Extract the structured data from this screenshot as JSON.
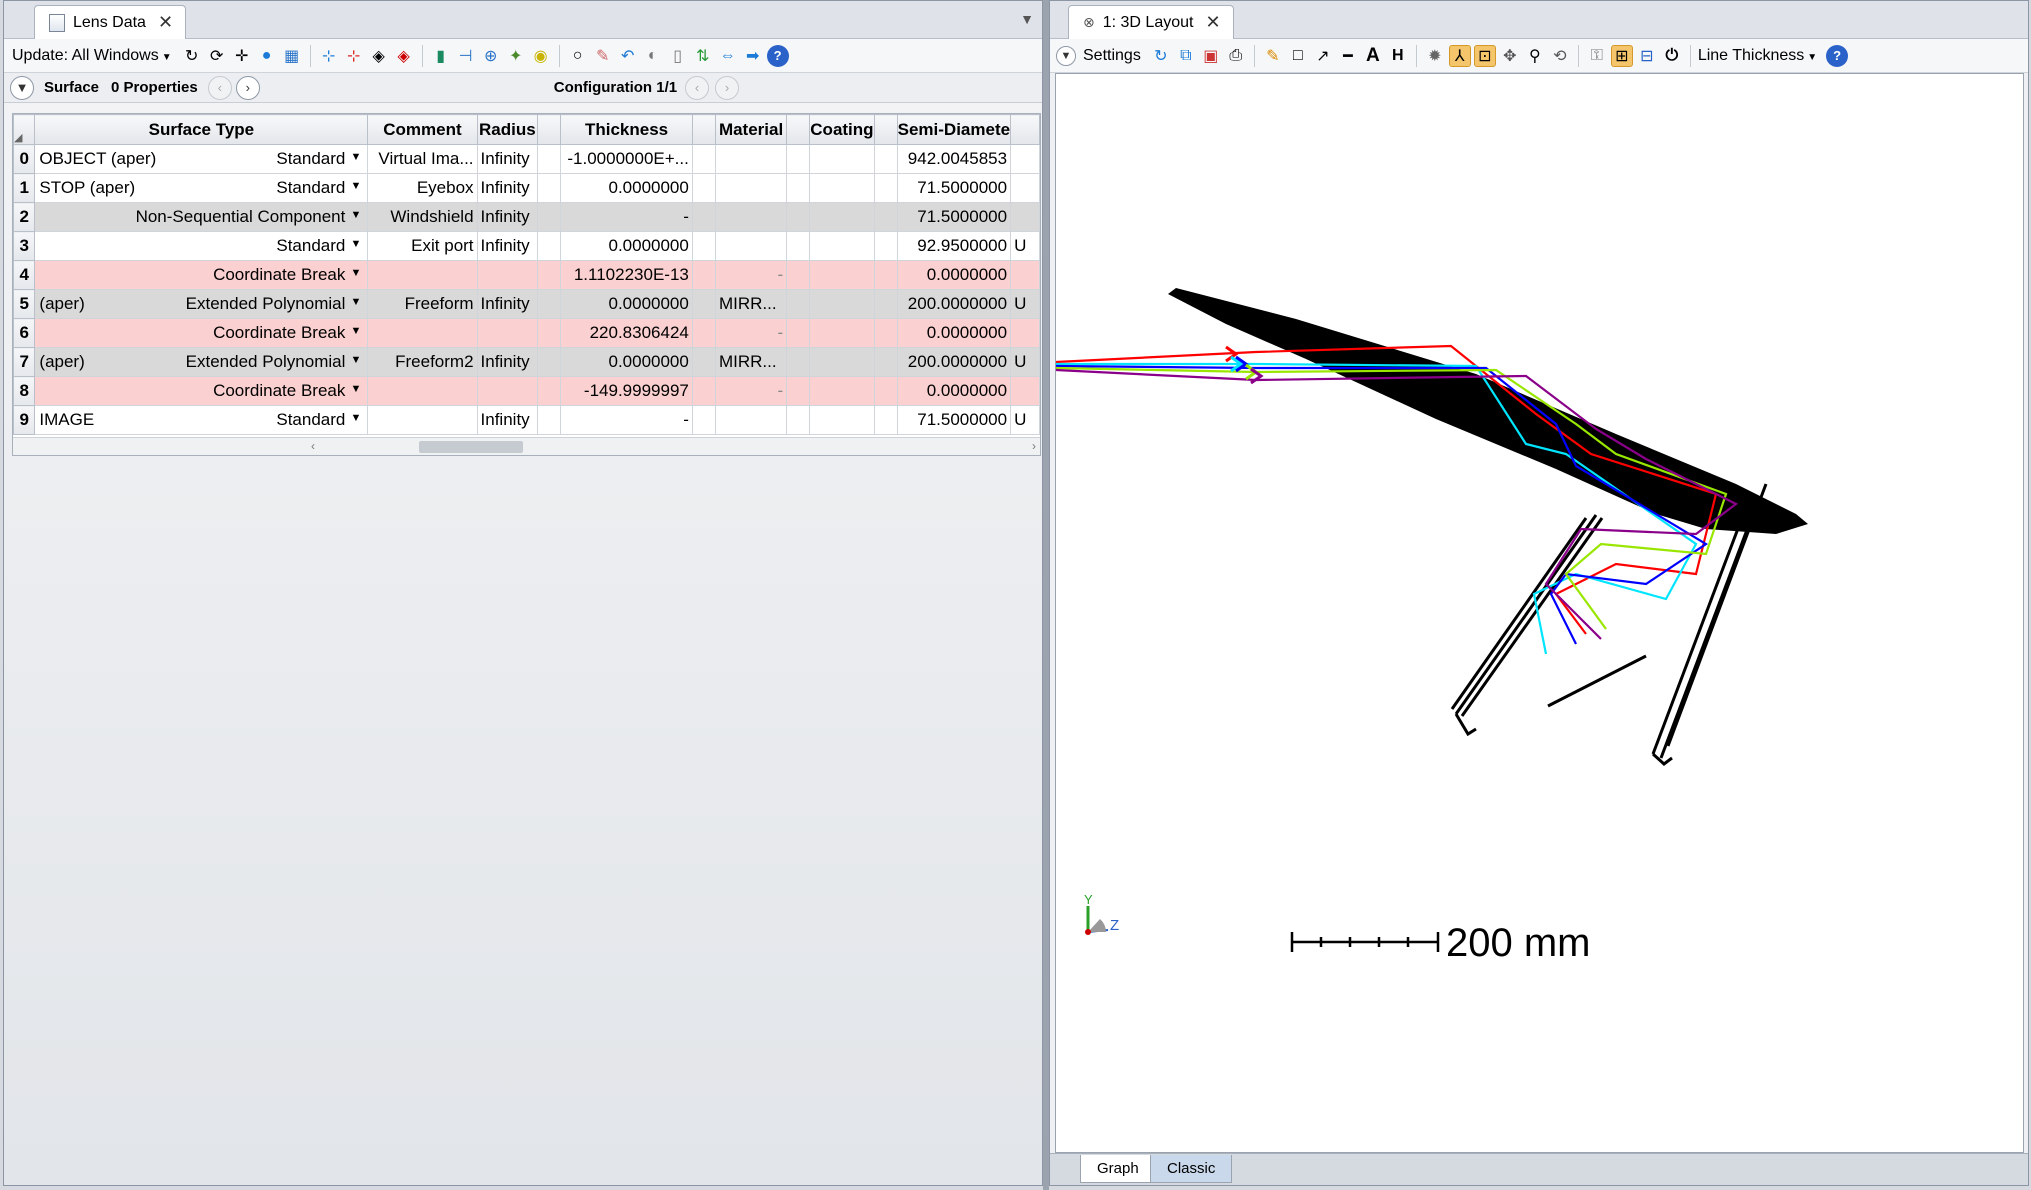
{
  "left_window": {
    "tab_title": "Lens Data",
    "toolbar": {
      "update_label": "Update: All Windows"
    },
    "subbar": {
      "surface_label": "Surface",
      "properties_label": "0 Properties",
      "configuration_label": "Configuration 1/1"
    },
    "table": {
      "headers": [
        "Surface Type",
        "Comment",
        "Radius",
        "Thickness",
        "Material",
        "Coating",
        "Semi-Diamete"
      ],
      "rows": [
        {
          "num": "0",
          "name": "OBJECT (aper)",
          "type": "Standard",
          "comment": "Virtual Ima...",
          "radius": "Infinity",
          "thickness": "-1.0000000E+...",
          "material": "",
          "coating": "",
          "semi": "942.0045853",
          "extra": "",
          "style": "white"
        },
        {
          "num": "1",
          "name": "STOP (aper)",
          "type": "Standard",
          "comment": "Eyebox",
          "radius": "Infinity",
          "thickness": "0.0000000",
          "material": "",
          "coating": "",
          "semi": "71.5000000",
          "extra": "",
          "style": "white"
        },
        {
          "num": "2",
          "name": "",
          "type": "Non-Sequential Component",
          "comment": "Windshield",
          "radius": "Infinity",
          "thickness": "-",
          "material": "",
          "coating": "",
          "semi": "71.5000000",
          "extra": "",
          "style": "gray"
        },
        {
          "num": "3",
          "name": "",
          "type": "Standard",
          "comment": "Exit port",
          "radius": "Infinity",
          "thickness": "0.0000000",
          "material": "",
          "coating": "",
          "semi": "92.9500000",
          "extra": "U",
          "style": "white"
        },
        {
          "num": "4",
          "name": "",
          "type": "Coordinate Break",
          "comment": "",
          "radius": "",
          "thickness": "1.1102230E-13",
          "material": "-",
          "coating": "",
          "semi": "0.0000000",
          "extra": "",
          "style": "pink"
        },
        {
          "num": "5",
          "name": "(aper)",
          "type": "Extended Polynomial",
          "comment": "Freeform",
          "radius": "Infinity",
          "thickness": "0.0000000",
          "material": "MIRR...",
          "coating": "",
          "semi": "200.0000000",
          "extra": "U",
          "style": "gray"
        },
        {
          "num": "6",
          "name": "",
          "type": "Coordinate Break",
          "comment": "",
          "radius": "",
          "thickness": "220.8306424",
          "material": "-",
          "coating": "",
          "semi": "0.0000000",
          "extra": "",
          "style": "pink"
        },
        {
          "num": "7",
          "name": "(aper)",
          "type": "Extended Polynomial",
          "comment": "Freeform2",
          "radius": "Infinity",
          "thickness": "0.0000000",
          "material": "MIRR...",
          "coating": "",
          "semi": "200.0000000",
          "extra": "U",
          "style": "gray"
        },
        {
          "num": "8",
          "name": "",
          "type": "Coordinate Break",
          "comment": "",
          "radius": "",
          "thickness": "-149.9999997",
          "material": "-",
          "coating": "",
          "semi": "0.0000000",
          "extra": "",
          "style": "pink"
        },
        {
          "num": "9",
          "name": "IMAGE",
          "type": "Standard",
          "comment": "",
          "radius": "Infinity",
          "thickness": "-",
          "material": "",
          "coating": "",
          "semi": "71.5000000",
          "extra": "U",
          "style": "white"
        }
      ]
    }
  },
  "right_window": {
    "tab_title": "1: 3D Layout",
    "toolbar": {
      "settings_label": "Settings",
      "line_thickness_label": "Line Thickness"
    },
    "scale_bar_label": "200 mm",
    "axis_y_label": "Y",
    "axis_z_label": "Z",
    "bottom_tabs": [
      "Graph",
      "Classic"
    ],
    "ray_colors": [
      "#ff0000",
      "#00e5ff",
      "#0000ff",
      "#99e600",
      "#8a008a"
    ]
  }
}
